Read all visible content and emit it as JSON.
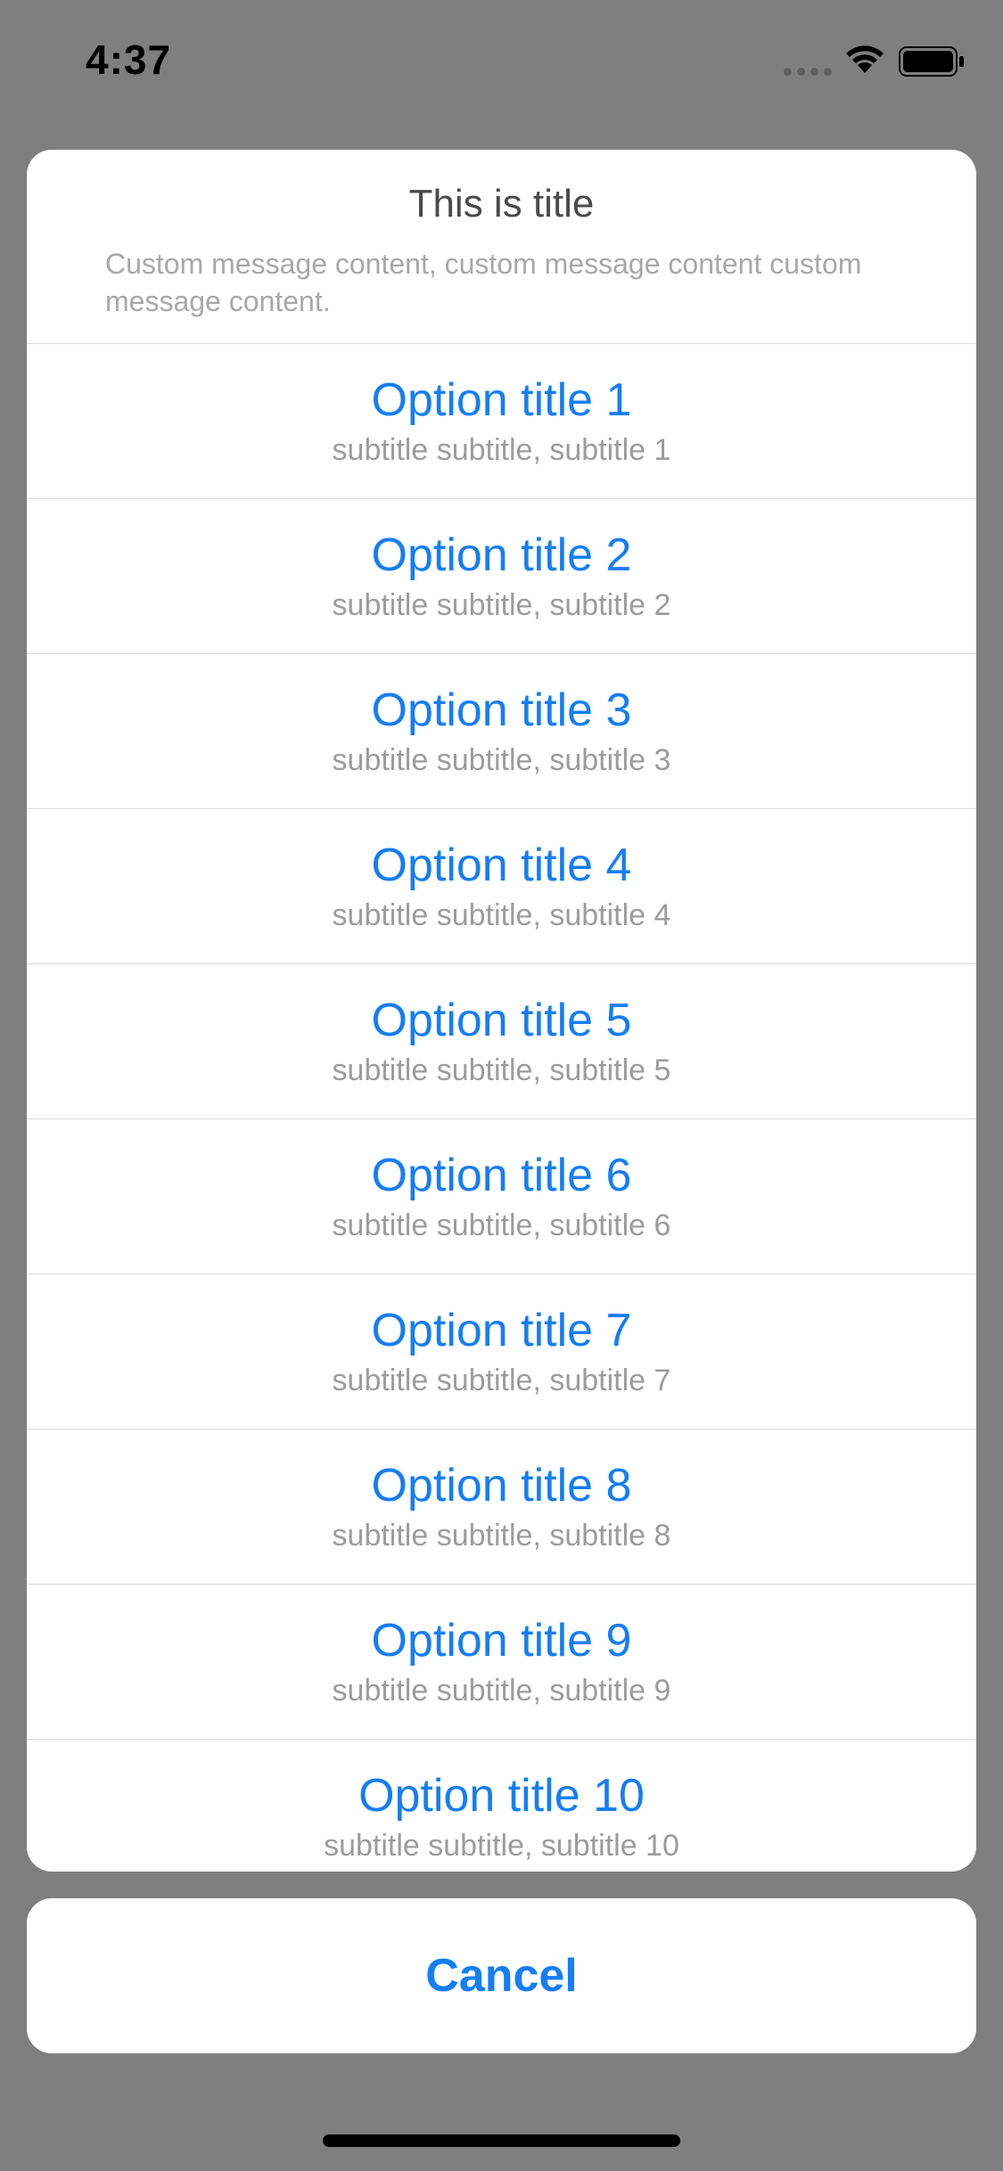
{
  "status_bar": {
    "time": "4:37"
  },
  "dialog": {
    "title": "This is title",
    "message": "Custom message content, custom message content custom message content.",
    "options": [
      {
        "title": "Option title 1",
        "subtitle": "subtitle subtitle, subtitle 1"
      },
      {
        "title": "Option title 2",
        "subtitle": "subtitle subtitle, subtitle 2"
      },
      {
        "title": "Option title 3",
        "subtitle": "subtitle subtitle, subtitle 3"
      },
      {
        "title": "Option title 4",
        "subtitle": "subtitle subtitle, subtitle 4"
      },
      {
        "title": "Option title 5",
        "subtitle": "subtitle subtitle, subtitle 5"
      },
      {
        "title": "Option title 6",
        "subtitle": "subtitle subtitle, subtitle 6"
      },
      {
        "title": "Option title 7",
        "subtitle": "subtitle subtitle, subtitle 7"
      },
      {
        "title": "Option title 8",
        "subtitle": "subtitle subtitle, subtitle 8"
      },
      {
        "title": "Option title 9",
        "subtitle": "subtitle subtitle, subtitle 9"
      },
      {
        "title": "Option title 10",
        "subtitle": "subtitle subtitle, subtitle 10"
      }
    ],
    "cancel_label": "Cancel"
  },
  "colors": {
    "accent": "#157EF5",
    "overlay": "#7F7F7F",
    "title_text": "#4A4A4A",
    "secondary_text": "#9C9C9C",
    "sheet_background": "#FFFFFF"
  },
  "icons": {
    "signal": "signal-dots-icon",
    "wifi": "wifi-icon",
    "battery": "battery-icon"
  }
}
